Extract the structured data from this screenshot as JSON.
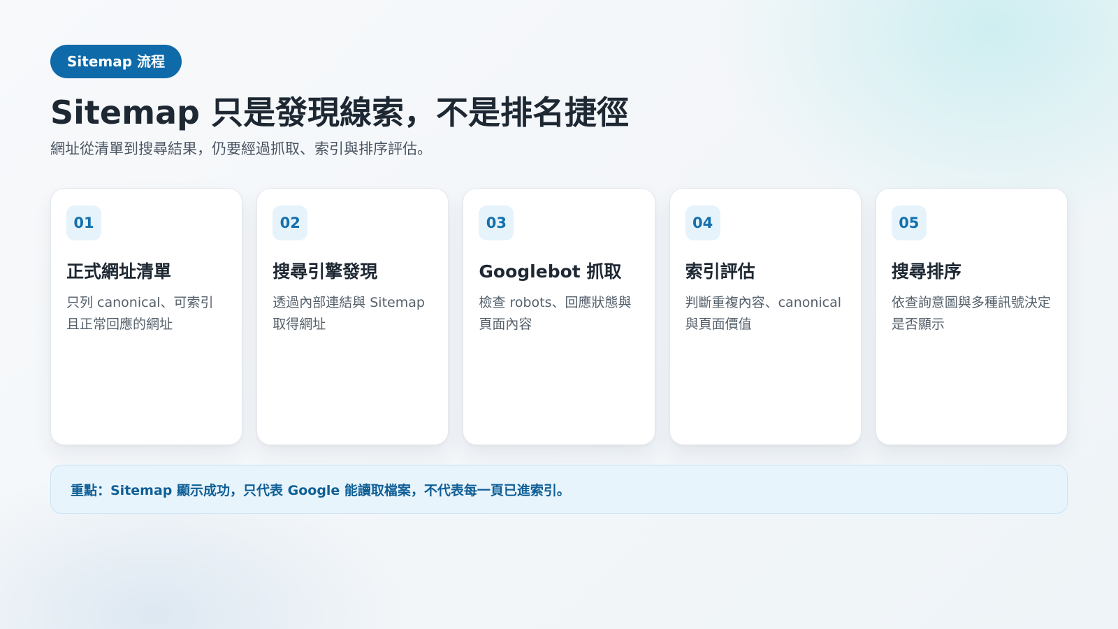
{
  "header": {
    "badge": "Sitemap 流程",
    "title": "Sitemap 只是發現線索，不是排名捷徑",
    "subtitle": "網址從清單到搜尋結果，仍要經過抓取、索引與排序評估。"
  },
  "steps": [
    {
      "number": "01",
      "title": "正式網址清單",
      "desc": "只列 canonical、可索引且正常回應的網址"
    },
    {
      "number": "02",
      "title": "搜尋引擎發現",
      "desc": "透過內部連結與 Sitemap 取得網址"
    },
    {
      "number": "03",
      "title": "Googlebot 抓取",
      "desc": "檢查 robots、回應狀態與頁面內容"
    },
    {
      "number": "04",
      "title": "索引評估",
      "desc": "判斷重複內容、canonical 與頁面價值"
    },
    {
      "number": "05",
      "title": "搜尋排序",
      "desc": "依查詢意圖與多種訊號決定是否顯示"
    }
  ],
  "note": {
    "text": "重點：Sitemap 顯示成功，只代表 Google 能讀取檔案，不代表每一頁已進索引。"
  },
  "colors": {
    "accent": "#0e6aa8",
    "badge_bg": "#e6f3fb",
    "note_bg": "#e8f4fc",
    "note_text": "#0f5f96"
  }
}
